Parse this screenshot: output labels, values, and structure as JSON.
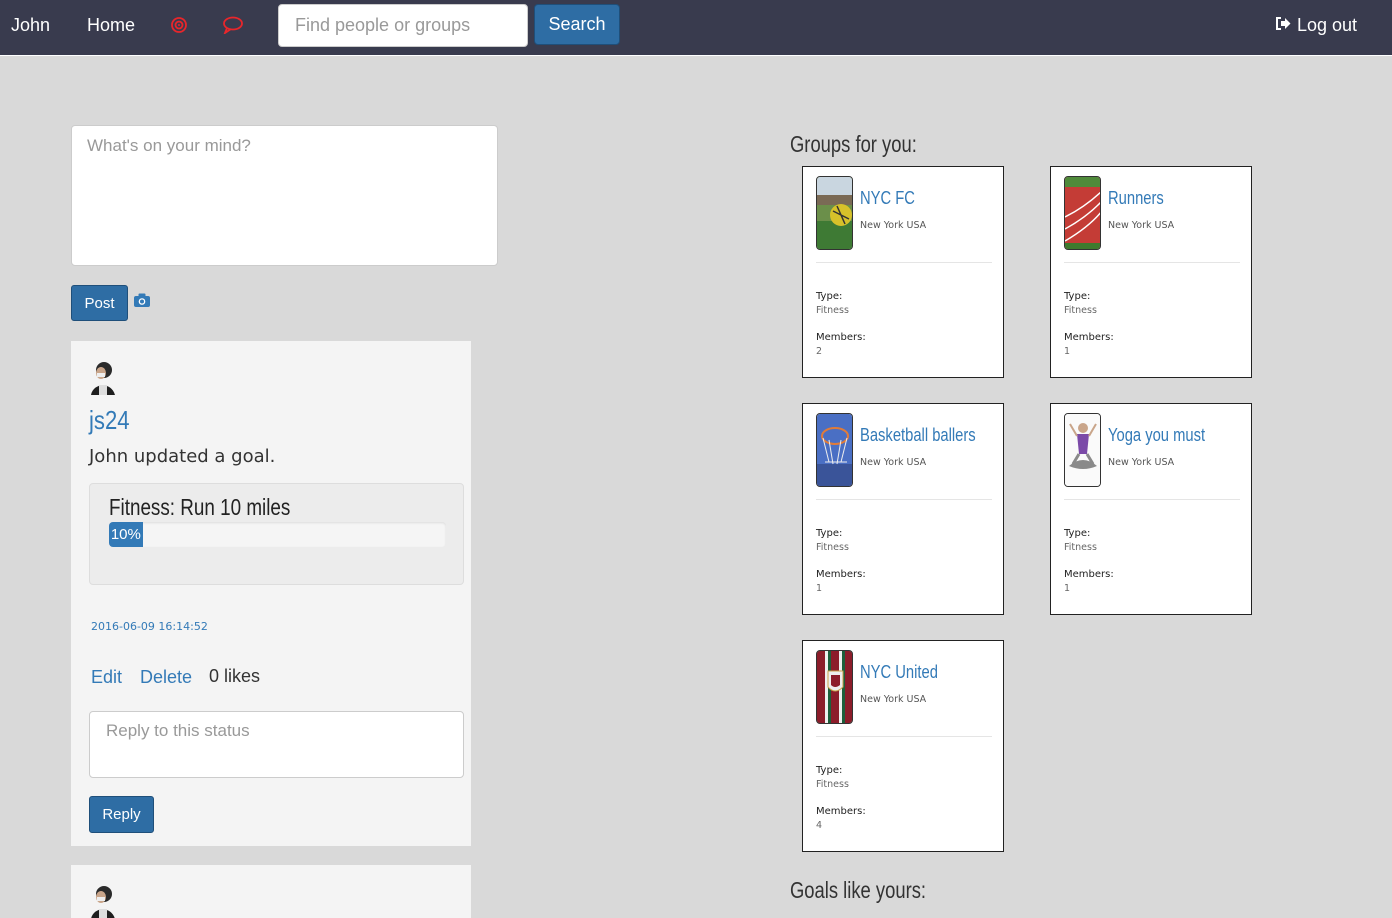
{
  "nav": {
    "user_label": "John",
    "home_label": "Home",
    "search_placeholder": "Find people or groups",
    "search_button": "Search",
    "logout_label": "Log out"
  },
  "composer": {
    "placeholder": "What's on your mind?",
    "post_button": "Post"
  },
  "feed": [
    {
      "username": "js24",
      "text": "John updated a goal.",
      "goal_title": "Fitness: Run 10 miles",
      "progress_label": "10%",
      "progress_value": 10,
      "timestamp": "2016-06-09 16:14:52",
      "edit_label": "Edit",
      "delete_label": "Delete",
      "likes_label": "0 likes",
      "reply_placeholder": "Reply to this status",
      "reply_button": "Reply"
    }
  ],
  "groups_title": "Groups for you:",
  "groups": [
    {
      "name": "NYC FC",
      "location": "New York USA",
      "type_label": "Type:",
      "type": "Fitness",
      "members_label": "Members:",
      "members": "2"
    },
    {
      "name": "Runners",
      "location": "New York USA",
      "type_label": "Type:",
      "type": "Fitness",
      "members_label": "Members:",
      "members": "1"
    },
    {
      "name": "Basketball ballers",
      "location": "New York USA",
      "type_label": "Type:",
      "type": "Fitness",
      "members_label": "Members:",
      "members": "1"
    },
    {
      "name": "Yoga you must",
      "location": "New York USA",
      "type_label": "Type:",
      "type": "Fitness",
      "members_label": "Members:",
      "members": "1"
    },
    {
      "name": "NYC United",
      "location": "New York USA",
      "type_label": "Type:",
      "type": "Fitness",
      "members_label": "Members:",
      "members": "4"
    }
  ],
  "goals_title": "Goals like yours:",
  "colors": {
    "navbar": "#393b4e",
    "primary": "#2e6da4",
    "link": "#337ab7",
    "notification_icons": "#e8262b",
    "background": "#d9d9d9"
  },
  "icons": [
    "target-icon",
    "chat-icon",
    "logout-icon",
    "camera-icon"
  ]
}
